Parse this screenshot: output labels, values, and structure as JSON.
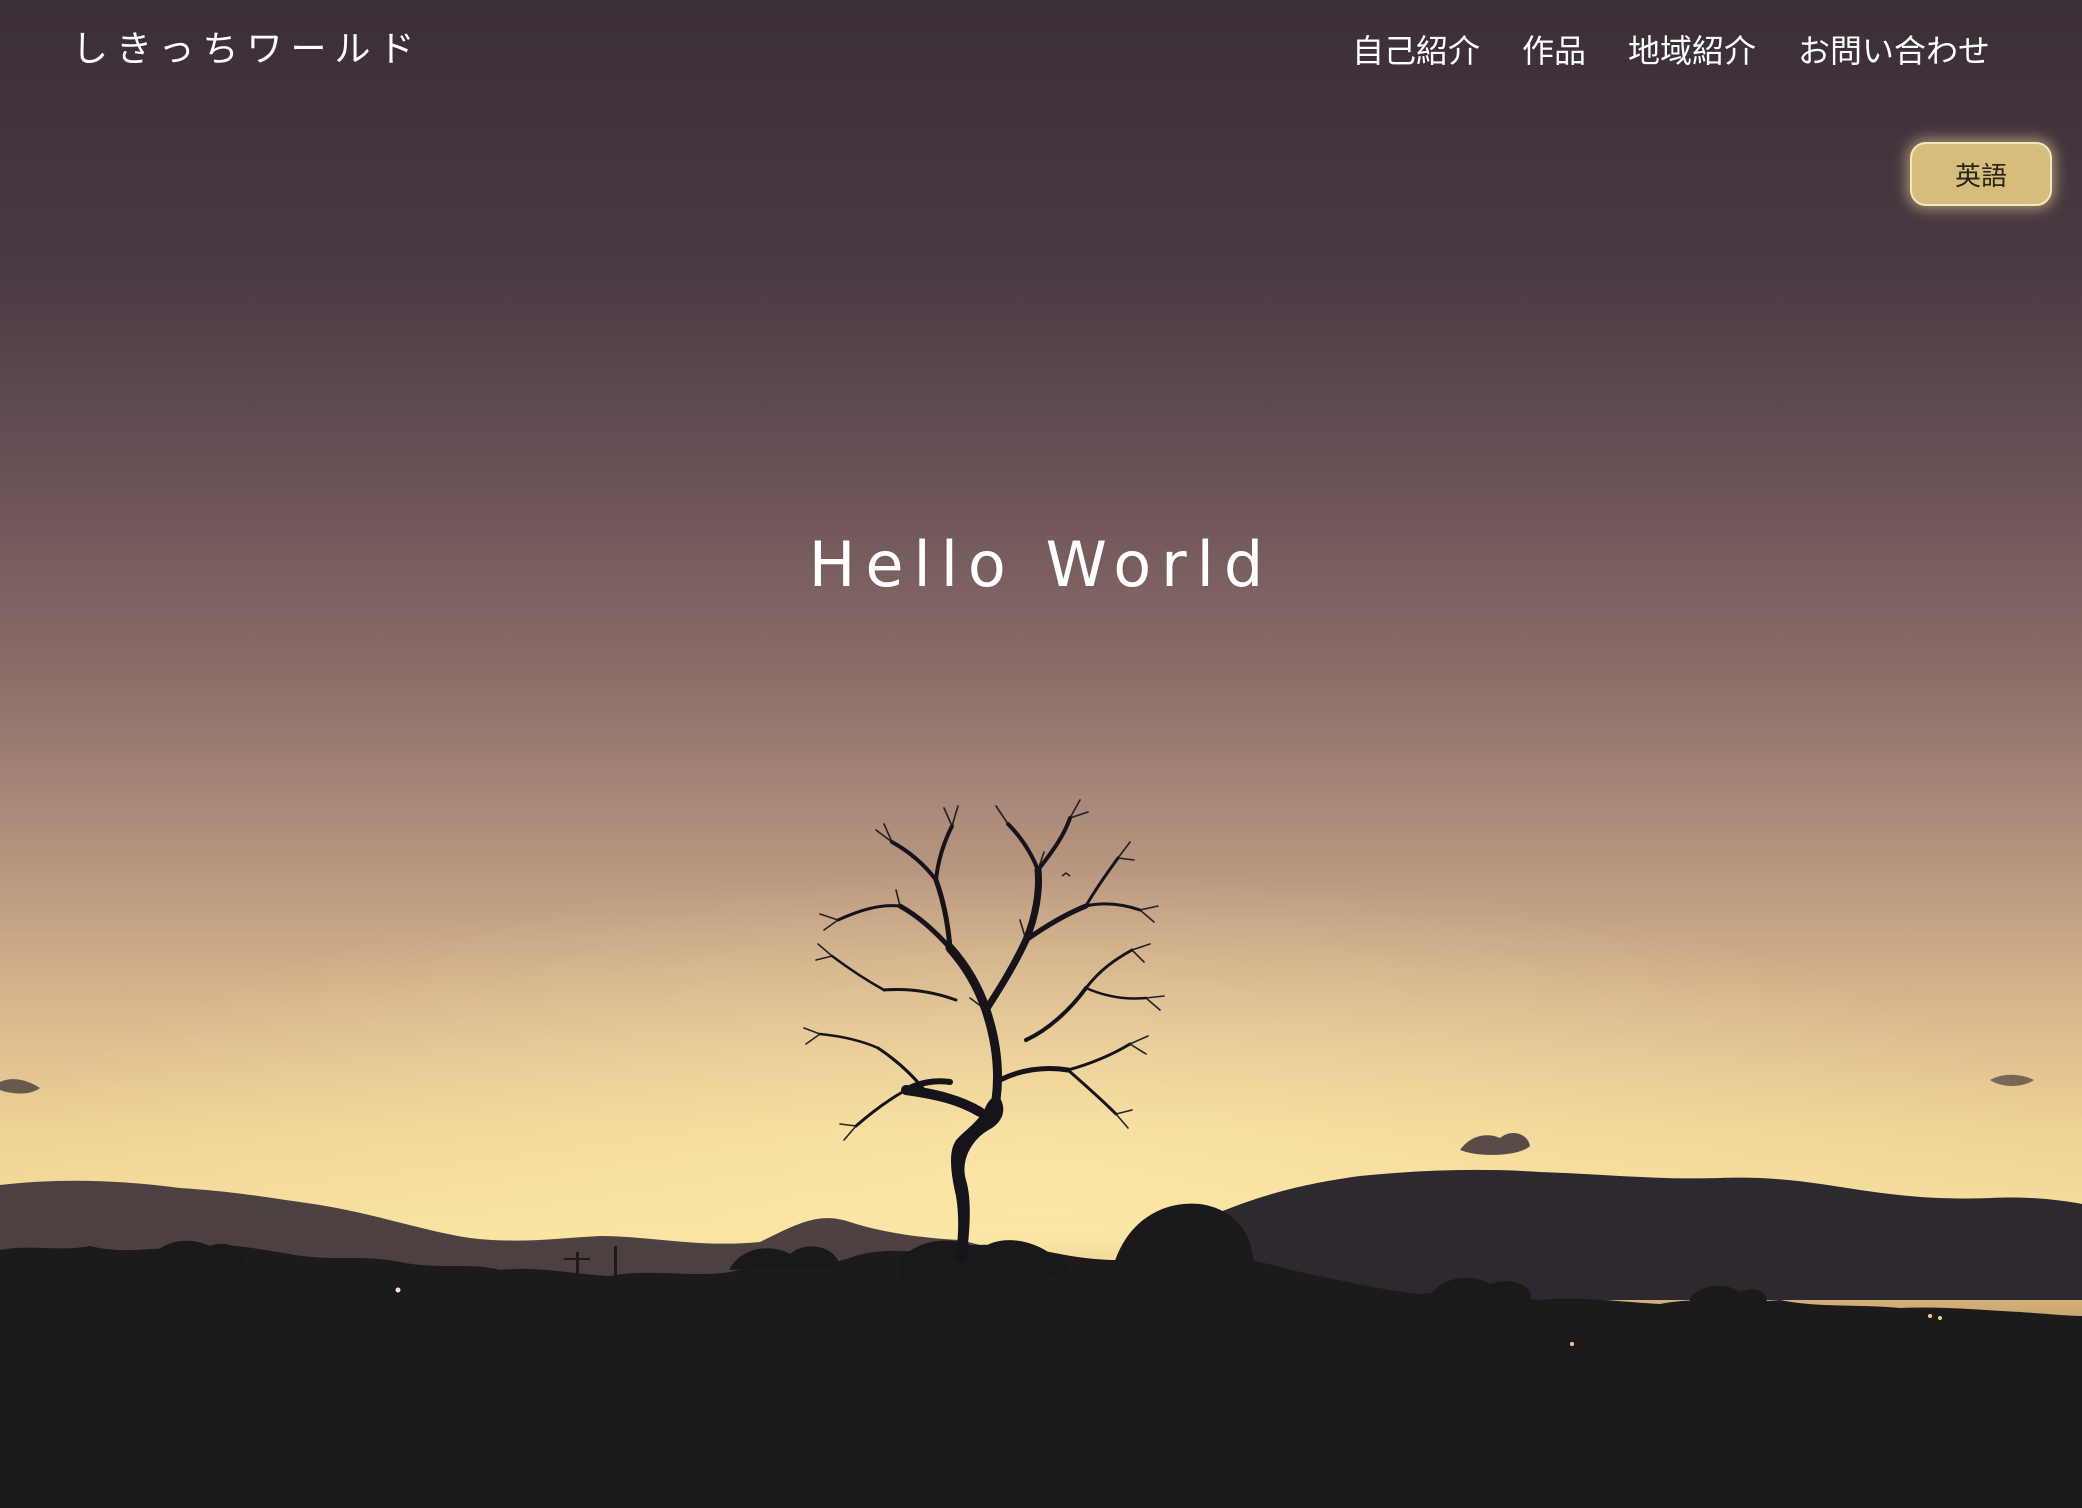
{
  "header": {
    "site_title": "しきっちワールド"
  },
  "nav": {
    "items": [
      {
        "label": "自己紹介"
      },
      {
        "label": "作品"
      },
      {
        "label": "地域紹介"
      },
      {
        "label": "お問い合わせ"
      }
    ]
  },
  "language_button": {
    "label": "英語"
  },
  "hero": {
    "heading": "Hello World",
    "image": "sunset-tree-silhouette"
  },
  "colors": {
    "sky_top": "#3d3039",
    "sky_mid": "#8a6b67",
    "sky_glow": "#f6dc96",
    "ground": "#1a1818",
    "button_fill": "#d7bd7c"
  }
}
